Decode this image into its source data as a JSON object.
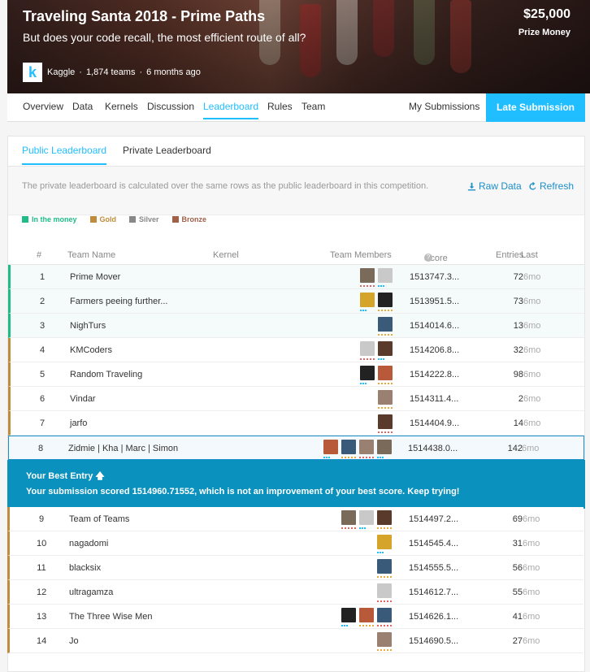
{
  "hero": {
    "title": "Traveling Santa 2018 - Prime Paths",
    "subtitle": "But does your code recall, the most efficient route of all?",
    "prize": "$25,000",
    "prize_label": "Prize Money",
    "host": "Kaggle",
    "teams": "1,874 teams",
    "ago": "6 months ago",
    "logo_letter": "k"
  },
  "nav": {
    "items": [
      "Overview",
      "Data",
      "Kernels",
      "Discussion",
      "Leaderboard",
      "Rules",
      "Team"
    ],
    "active": "Leaderboard",
    "my_submissions": "My Submissions",
    "late_submission": "Late Submission"
  },
  "subtabs": [
    "Public Leaderboard",
    "Private Leaderboard"
  ],
  "info": {
    "note": "The private leaderboard is calculated over the same rows as the public leaderboard in this competition.",
    "raw_data": "Raw Data",
    "refresh": "Refresh"
  },
  "legend": [
    {
      "label": "In the money",
      "color": "#1ebc86"
    },
    {
      "label": "Gold",
      "color": "#c08b3a"
    },
    {
      "label": "Silver",
      "color": "#888888"
    },
    {
      "label": "Bronze",
      "color": "#a0604a"
    }
  ],
  "table": {
    "headers": {
      "rank": "#",
      "team": "Team Name",
      "kernel": "Kernel",
      "members": "Team Members",
      "score": "Score",
      "entries": "Entries",
      "last": "Last"
    },
    "rows": [
      {
        "rank": "1",
        "team": "Prime Mover",
        "score": "1513747.3...",
        "entries": "72",
        "last": "6mo",
        "tier": "money",
        "members": 2
      },
      {
        "rank": "2",
        "team": "Farmers peeing further...",
        "score": "1513951.5...",
        "entries": "73",
        "last": "6mo",
        "tier": "money",
        "members": 2
      },
      {
        "rank": "3",
        "team": "NighTurs",
        "score": "1514014.6...",
        "entries": "13",
        "last": "6mo",
        "tier": "money",
        "members": 1
      },
      {
        "rank": "4",
        "team": "KMCoders",
        "score": "1514206.8...",
        "entries": "32",
        "last": "6mo",
        "tier": "gold",
        "members": 2
      },
      {
        "rank": "5",
        "team": "Random Traveling",
        "score": "1514222.8...",
        "entries": "98",
        "last": "6mo",
        "tier": "gold",
        "members": 2
      },
      {
        "rank": "6",
        "team": "Vindar",
        "score": "1514311.4...",
        "entries": "2",
        "last": "6mo",
        "tier": "gold",
        "members": 1
      },
      {
        "rank": "7",
        "team": "jarfo",
        "score": "1514404.9...",
        "entries": "14",
        "last": "6mo",
        "tier": "gold",
        "members": 1
      },
      {
        "rank": "8",
        "team": "Zidmie | Kha | Marc | Simon",
        "score": "1514438.0...",
        "entries": "142",
        "last": "6mo",
        "tier": "you",
        "members": 4
      }
    ],
    "rows_after": [
      {
        "rank": "9",
        "team": "Team of Teams",
        "score": "1514497.2...",
        "entries": "69",
        "last": "6mo",
        "tier": "gold",
        "members": 3
      },
      {
        "rank": "10",
        "team": "nagadomi",
        "score": "1514545.4...",
        "entries": "31",
        "last": "6mo",
        "tier": "gold",
        "members": 1
      },
      {
        "rank": "11",
        "team": "blacksix",
        "score": "1514555.5...",
        "entries": "56",
        "last": "6mo",
        "tier": "gold",
        "members": 1
      },
      {
        "rank": "12",
        "team": "ultragamza",
        "score": "1514612.7...",
        "entries": "55",
        "last": "6mo",
        "tier": "gold",
        "members": 1
      },
      {
        "rank": "13",
        "team": "The Three Wise Men",
        "score": "1514626.1...",
        "entries": "41",
        "last": "6mo",
        "tier": "gold",
        "members": 3
      },
      {
        "rank": "14",
        "team": "Jo",
        "score": "1514690.5...",
        "entries": "27",
        "last": "6mo",
        "tier": "gold",
        "members": 1
      }
    ]
  },
  "best_entry": {
    "title": "Your Best Entry",
    "message": "Your submission scored 1514960.71552, which is not an improvement of your best score. Keep trying!"
  }
}
